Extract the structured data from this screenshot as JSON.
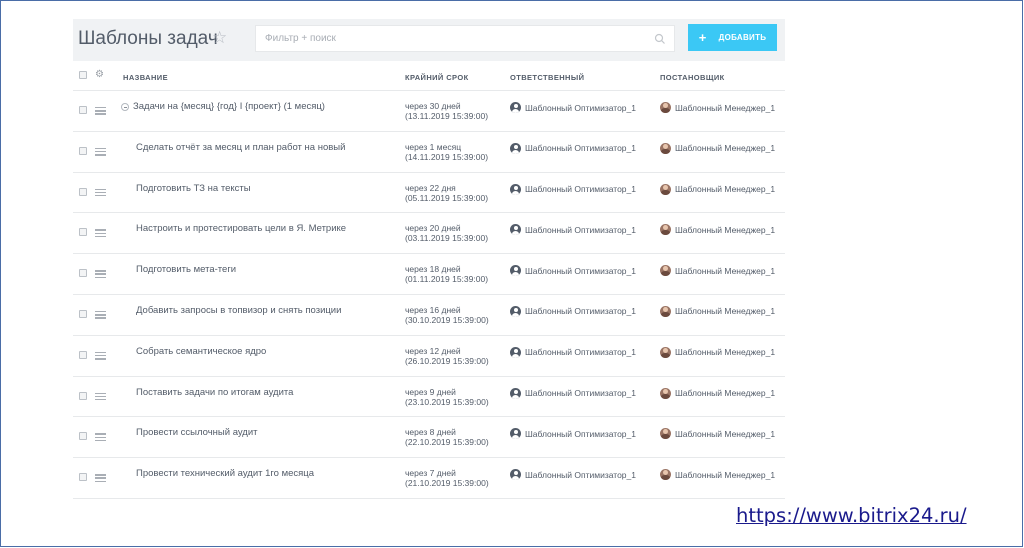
{
  "header": {
    "title": "Шаблоны задач",
    "search_placeholder": "Фильтр + поиск",
    "add_label": "ДОБАВИТЬ"
  },
  "columns": {
    "name": "НАЗВАНИЕ",
    "deadline": "КРАЙНИЙ СРОК",
    "responsible": "ОТВЕТСТВЕННЫЙ",
    "creator": "ПОСТАНОВЩИК"
  },
  "rows": [
    {
      "name": "Задачи на {месяц} {год} I {проект} (1 месяц)",
      "deadline_rel": "через 30 дней",
      "deadline_date": "(13.11.2019 15:39:00)",
      "responsible": "Шаблонный Оптимизатор_1",
      "creator": "Шаблонный Менеджер_1"
    },
    {
      "name": "Сделать отчёт за месяц и план работ на новый",
      "deadline_rel": "через 1 месяц",
      "deadline_date": "(14.11.2019 15:39:00)",
      "responsible": "Шаблонный Оптимизатор_1",
      "creator": "Шаблонный Менеджер_1"
    },
    {
      "name": "Подготовить ТЗ на тексты",
      "deadline_rel": "через 22 дня",
      "deadline_date": "(05.11.2019 15:39:00)",
      "responsible": "Шаблонный Оптимизатор_1",
      "creator": "Шаблонный Менеджер_1"
    },
    {
      "name": "Настроить и протестировать цели в Я. Метрике",
      "deadline_rel": "через 20 дней",
      "deadline_date": "(03.11.2019 15:39:00)",
      "responsible": "Шаблонный Оптимизатор_1",
      "creator": "Шаблонный Менеджер_1"
    },
    {
      "name": "Подготовить мета-теги",
      "deadline_rel": "через 18 дней",
      "deadline_date": "(01.11.2019 15:39:00)",
      "responsible": "Шаблонный Оптимизатор_1",
      "creator": "Шаблонный Менеджер_1"
    },
    {
      "name": "Добавить запросы в топвизор и снять позиции",
      "deadline_rel": "через 16 дней",
      "deadline_date": "(30.10.2019 15:39:00)",
      "responsible": "Шаблонный Оптимизатор_1",
      "creator": "Шаблонный Менеджер_1"
    },
    {
      "name": "Собрать семантическое ядро",
      "deadline_rel": "через 12 дней",
      "deadline_date": "(26.10.2019 15:39:00)",
      "responsible": "Шаблонный Оптимизатор_1",
      "creator": "Шаблонный Менеджер_1"
    },
    {
      "name": "Поставить задачи по итогам аудита",
      "deadline_rel": "через 9 дней",
      "deadline_date": "(23.10.2019 15:39:00)",
      "responsible": "Шаблонный Оптимизатор_1",
      "creator": "Шаблонный Менеджер_1"
    },
    {
      "name": "Провести ссылочный аудит",
      "deadline_rel": "через 8 дней",
      "deadline_date": "(22.10.2019 15:39:00)",
      "responsible": "Шаблонный Оптимизатор_1",
      "creator": "Шаблонный Менеджер_1"
    },
    {
      "name": "Провести технический аудит 1го месяца",
      "deadline_rel": "через 7 дней",
      "deadline_date": "(21.10.2019 15:39:00)",
      "responsible": "Шаблонный Оптимизатор_1",
      "creator": "Шаблонный Менеджер_1"
    }
  ],
  "footer": {
    "link": "https://www.bitrix24.ru/"
  },
  "colors": {
    "accent": "#3bc8f5",
    "header_bg": "#f0f2f4",
    "text": "#535c69",
    "link": "#1a1a8c"
  }
}
